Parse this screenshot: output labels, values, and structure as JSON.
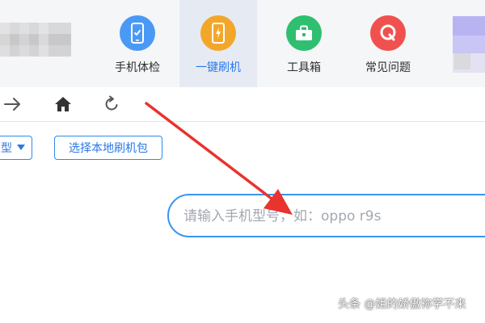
{
  "nav": {
    "items": [
      {
        "label": "手机体检",
        "icon": "phone-checkup-icon",
        "color": "#4a9af5"
      },
      {
        "label": "一键刷机",
        "icon": "one-click-flash-icon",
        "color": "#f3a72a",
        "active": true
      },
      {
        "label": "工具箱",
        "icon": "toolbox-icon",
        "color": "#2fbf71"
      },
      {
        "label": "常见问题",
        "icon": "faq-icon",
        "color": "#f0514f"
      }
    ]
  },
  "toolbar": {
    "icons": [
      "forward-arrow-icon",
      "home-icon",
      "refresh-icon"
    ]
  },
  "filters": {
    "model_dropdown_label": "型",
    "local_package_button": "选择本地刷机包"
  },
  "search": {
    "placeholder": "请输入手机型号，如：oppo r9s"
  },
  "watermark": "头条 @姐的娇傲祢学不来",
  "colors": {
    "accent": "#2b8cf0",
    "annotation_arrow": "#e8332e"
  }
}
